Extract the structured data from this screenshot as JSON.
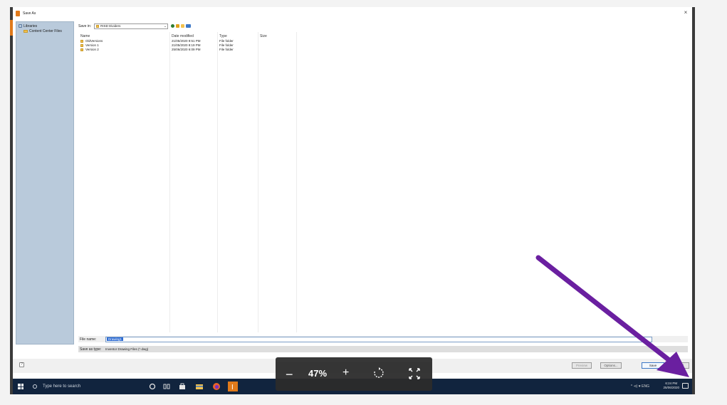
{
  "window": {
    "title": "Save As",
    "close_glyph": "×"
  },
  "sidebar": {
    "items": [
      {
        "label": "Libraries",
        "icon": "library-icon"
      },
      {
        "label": "Content Center Files",
        "icon": "folder-icon"
      }
    ]
  },
  "toolbar": {
    "save_in_label": "Save in:",
    "save_in_value": "RISD Dividers",
    "chevron_glyph": "⌄"
  },
  "file_list": {
    "columns": [
      "Name",
      "Date modified",
      "Type",
      "Size"
    ],
    "rows": [
      {
        "name": "OldVersions",
        "date": "21/05/2020 9:51 PM",
        "type": "File folder"
      },
      {
        "name": "Version 1",
        "date": "21/05/2020 8:19 PM",
        "type": "File folder"
      },
      {
        "name": "Version 2",
        "date": "25/06/2020 6:09 PM",
        "type": "File folder"
      }
    ]
  },
  "filename": {
    "label": "File name:",
    "value": "Drawing1"
  },
  "filetype": {
    "label": "Save as type:",
    "value": "Inventor Drawing Files (*.dwg)"
  },
  "buttons": {
    "help_glyph": "?",
    "preview": "Preview",
    "options": "Options...",
    "save": "Save",
    "cancel": "Cancel"
  },
  "taskbar": {
    "search_placeholder": "Type here to search",
    "tray_text": "^  ⊲)  ♥  ENG",
    "time": "6:24 PM",
    "date": "25/06/2020"
  },
  "zoom": {
    "minus": "−",
    "level": "47%",
    "plus": "+"
  },
  "colors": {
    "accent_orange": "#e07a1b",
    "taskbar": "#11243e",
    "annotation_arrow": "#6a1fa0",
    "selection": "#2d6bd3"
  }
}
